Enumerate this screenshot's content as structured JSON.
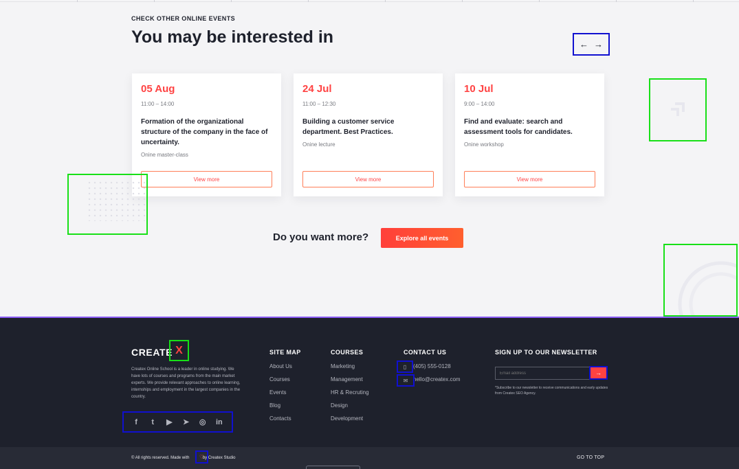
{
  "section": {
    "eyebrow": "CHECK OTHER ONLINE EVENTS",
    "title": "You may be interested in",
    "prev_icon": "←",
    "next_icon": "→"
  },
  "events": [
    {
      "date": "05 Aug",
      "time": "11:00 – 14:00",
      "title": "Formation of the organizational structure of the company in the face of uncertainty.",
      "type": "Onine master-class",
      "button": "View more"
    },
    {
      "date": "24 Jul",
      "time": "11:00 – 12:30",
      "title": "Building a customer service department. Best Practices.",
      "type": "Onine lecture",
      "button": "View more"
    },
    {
      "date": "10 Jul",
      "time": "9:00 – 14:00",
      "title": "Find and evaluate: search and assessment tools for candidates.",
      "type": "Onine workshop",
      "button": "View more"
    }
  ],
  "cta": {
    "question": "Do you want more?",
    "button": "Explore all events"
  },
  "footer": {
    "logo_text": "CREATE",
    "logo_mark": "X",
    "about": "Createx Online School is a leader in online studying. We have lots of courses and programs from the main market experts. We provide relevant approaches to online learning, internships and employment in the largest companies in the country.",
    "social": [
      "f",
      "t",
      "▶",
      "➤",
      "◎",
      "in"
    ],
    "sitemap": {
      "heading": "SITE MAP",
      "links": [
        "About Us",
        "Courses",
        "Events",
        "Blog",
        "Contacts"
      ]
    },
    "courses": {
      "heading": "COURSES",
      "links": [
        "Marketing",
        "Management",
        "HR & Recruting",
        "Design",
        "Development"
      ]
    },
    "contact": {
      "heading": "CONTACT US",
      "phone": "(405) 555-0128",
      "email": "hello@createx.com",
      "phone_icon": "▯",
      "email_icon": "✉"
    },
    "newsletter": {
      "heading": "SIGN UP TO OUR NEWSLETTER",
      "placeholder": "Email address",
      "submit_icon": "→",
      "note": "*Subscribe to our newsletter to receive communications and early updates from Createx SEO Agency."
    }
  },
  "bottom": {
    "copyright_before": "© All rights reserved. Made with",
    "heart_icon": "♡",
    "copyright_after": "by Createx Studio",
    "go_top": "GO TO TOP"
  }
}
